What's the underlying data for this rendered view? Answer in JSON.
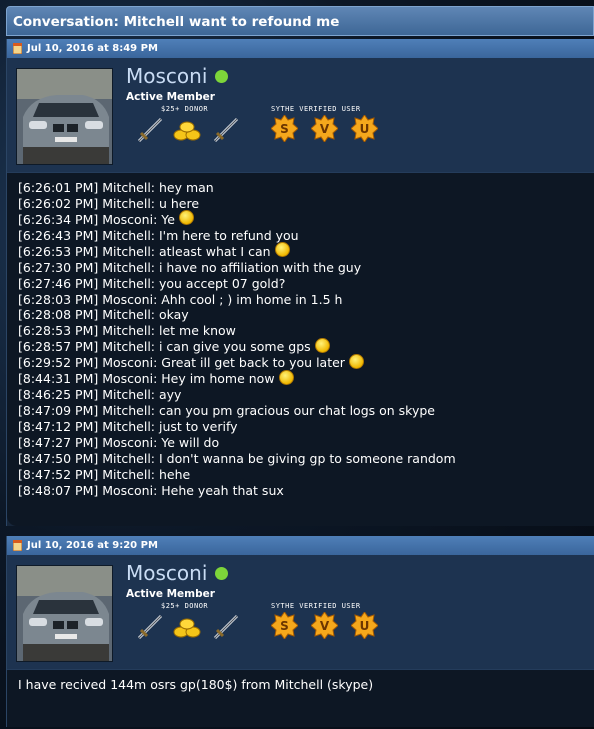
{
  "conversation": {
    "title": "Conversation: Mitchell want to refound me"
  },
  "posts": [
    {
      "date": "Jul 10, 2016 at 8:49 PM",
      "user": {
        "name": "Mosconi",
        "title": "Active Member",
        "awards": {
          "donor_caption": "$25+ DONOR",
          "sythe_caption": "SYTHE VERIFIED USER",
          "sythe_letters": [
            "S",
            "V",
            "U"
          ]
        }
      },
      "messages": [
        {
          "text": "[6:26:01 PM] Mitchell: hey man",
          "smiley": false
        },
        {
          "text": "[6:26:02 PM] Mitchell: u here",
          "smiley": false
        },
        {
          "text": "[6:26:34 PM] Mosconi: Ye",
          "smiley": true
        },
        {
          "text": "[6:26:43 PM] Mitchell: I'm here to refund you",
          "smiley": false
        },
        {
          "text": "[6:26:53 PM] Mitchell: atleast what I can",
          "smiley": true
        },
        {
          "text": "[6:27:30 PM] Mitchell: i have no affiliation with the guy",
          "smiley": false
        },
        {
          "text": "[6:27:46 PM] Mitchell: you accept 07 gold?",
          "smiley": false
        },
        {
          "text": "[6:28:03 PM] Mosconi: Ahh cool ; ) im home in 1.5 h",
          "smiley": false
        },
        {
          "text": "[6:28:08 PM] Mitchell: okay",
          "smiley": false
        },
        {
          "text": "[6:28:53 PM] Mitchell: let me know",
          "smiley": false
        },
        {
          "text": "[6:28:57 PM] Mitchell: i can give you some gps",
          "smiley": true
        },
        {
          "text": "[6:29:52 PM] Mosconi: Great ill get back to you later",
          "smiley": true
        },
        {
          "text": "[8:44:31 PM] Mosconi: Hey im home now",
          "smiley": true
        },
        {
          "text": "[8:46:25 PM] Mitchell: ayy",
          "smiley": false
        },
        {
          "text": "[8:47:09 PM] Mitchell: can you pm gracious our chat logs on skype",
          "smiley": false
        },
        {
          "text": "[8:47:12 PM] Mitchell: just to verify",
          "smiley": false
        },
        {
          "text": "[8:47:27 PM] Mosconi: Ye will do",
          "smiley": false
        },
        {
          "text": "[8:47:50 PM] Mitchell: I don't wanna be giving gp to someone random",
          "smiley": false
        },
        {
          "text": "[8:47:52 PM] Mitchell: hehe",
          "smiley": false
        },
        {
          "text": "[8:48:07 PM] Mosconi: Hehe yeah that sux",
          "smiley": false
        }
      ]
    },
    {
      "date": "Jul 10, 2016 at 9:20 PM",
      "user": {
        "name": "Mosconi",
        "title": "Active Member",
        "awards": {
          "donor_caption": "$25+ DONOR",
          "sythe_caption": "SYTHE VERIFIED USER",
          "sythe_letters": [
            "S",
            "V",
            "U"
          ]
        }
      },
      "body": "I have recived 144m osrs gp(180$) from Mitchell (skype)"
    }
  ],
  "colors": {
    "header": "#4f76a6",
    "online": "#7dd53a",
    "username": "#c9dcf4",
    "badge": "#f5a81c"
  }
}
